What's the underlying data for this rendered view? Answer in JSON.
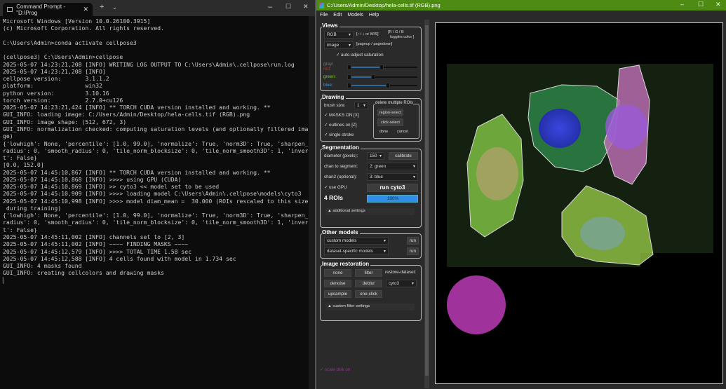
{
  "terminal": {
    "tab_title": "Command Prompt - \"D:\\Prog",
    "text": "Microsoft Windows [Version 10.0.26100.3915]\n(c) Microsoft Corporation. All rights reserved.\n\nC:\\Users\\Admin>conda activate cellpose3\n\n(cellpose3) C:\\Users\\Admin>cellpose\n2025-05-07 14:23:21,208 [INFO] WRITING LOG OUTPUT TO C:\\Users\\Admin\\.cellpose\\run.log\n2025-05-07 14:23:21,208 [INFO]\ncellpose version:       3.1.1.2\nplatform:               win32\npython version:         3.10.16\ntorch version:          2.7.0+cu126\n2025-05-07 14:23:21,424 [INFO] ** TORCH CUDA version installed and working. **\nGUI_INFO: loading image: C:/Users/Admin/Desktop/hela-cells.tif (RGB).png\nGUI_INFO: image shape: (512, 672, 3)\nGUI_INFO: normalization checked: computing saturation levels (and optionally filtered ima\nge)\n{'lowhigh': None, 'percentile': [1.0, 99.0], 'normalize': True, 'norm3D': True, 'sharpen_\nradius': 0, 'smooth_radius': 0, 'tile_norm_blocksize': 0, 'tile_norm_smooth3D': 1, 'inver\nt': False}\n[0.0, 152.0]\n2025-05-07 14:45:10,867 [INFO] ** TORCH CUDA version installed and working. **\n2025-05-07 14:45:10,868 [INFO] >>>> using GPU (CUDA)\n2025-05-07 14:45:10,869 [INFO] >> cyto3 << model set to be used\n2025-05-07 14:45:10,909 [INFO] >>>> loading model C:\\Users\\Admin\\.cellpose\\models\\cyto3\n2025-05-07 14:45:10,998 [INFO] >>>> model diam_mean =  30.000 (ROIs rescaled to this size\n during training)\n{'lowhigh': None, 'percentile': [1.0, 99.0], 'normalize': True, 'norm3D': True, 'sharpen_\nradius': 0, 'smooth_radius': 0, 'tile_norm_blocksize': 0, 'tile_norm_smooth3D': 1, 'inver\nt': False}\n2025-05-07 14:45:11,002 [INFO] channels set to [2, 3]\n2025-05-07 14:45:11,002 [INFO] ~~~~ FINDING MASKS ~~~~\n2025-05-07 14:45:12,579 [INFO] >>>> TOTAL TIME 1.58 sec\n2025-05-07 14:45:12,588 [INFO] 4 cells found with model in 1.734 sec\nGUI_INFO: 4 masks found\nGUI_INFO: creating cellcolors and drawing masks\n▏"
  },
  "cellpose": {
    "title": "C:/Users/Admin/Desktop/hela-cells.tif (RGB).png",
    "menu": [
      "File",
      "Edit",
      "Models",
      "Help"
    ],
    "views": {
      "title": "Views",
      "color_mode": "RGB",
      "color_hint": "[↑ / ↓ or W/S]",
      "rgb_hint_1": "[R / G / B",
      "rgb_hint_2": "toggles color ]",
      "view_mode": "image",
      "view_hint": "[pageup / pagedown]",
      "auto_adjust": "auto-adjust saturation",
      "gray_label": "gray/",
      "red_label": "red:",
      "green_label": "green:",
      "blue_label": "blue:"
    },
    "drawing": {
      "title": "Drawing",
      "brush_label": "brush size:",
      "brush_value": "1",
      "masks_on": "MASKS ON [X]",
      "outlines_on": "outlines on [Z]",
      "single_stroke": "single stroke",
      "delete_title": "delete multiple ROIs",
      "region_select": "region-select",
      "click_select": "click-select",
      "done": "done",
      "cancel": "cancel"
    },
    "segmentation": {
      "title": "Segmentation",
      "diameter_label": "diameter (pixels):",
      "diameter_value": "150",
      "calibrate": "calibrate",
      "chan_label": "chan to segment:",
      "chan_value": "2: green",
      "chan2_label": "chan2 (optional):",
      "chan2_value": "3: blue",
      "use_gpu": "use GPU",
      "run": "run cyto3",
      "rois": "4 ROIs",
      "progress_label": "100%",
      "progress": 100,
      "additional": "▲ additional settings"
    },
    "other_models": {
      "title": "Other models",
      "custom": "custom models",
      "dataset": "dataset-specific models",
      "run": "run"
    },
    "restoration": {
      "title": "Image restoration",
      "none": "none",
      "filter": "filter",
      "restore_dataset": "restore-dataset:",
      "denoise": "denoise",
      "deblur": "deblur",
      "model": "cyto3",
      "upsample": "upsample",
      "one_click": "one-click",
      "custom": "▲ custom filter settings"
    },
    "scale_disk": "scale disk on",
    "colors": {
      "titlebar": "#4e8b12",
      "progress": "#2f8fe8",
      "disk": "#a0329b"
    }
  }
}
